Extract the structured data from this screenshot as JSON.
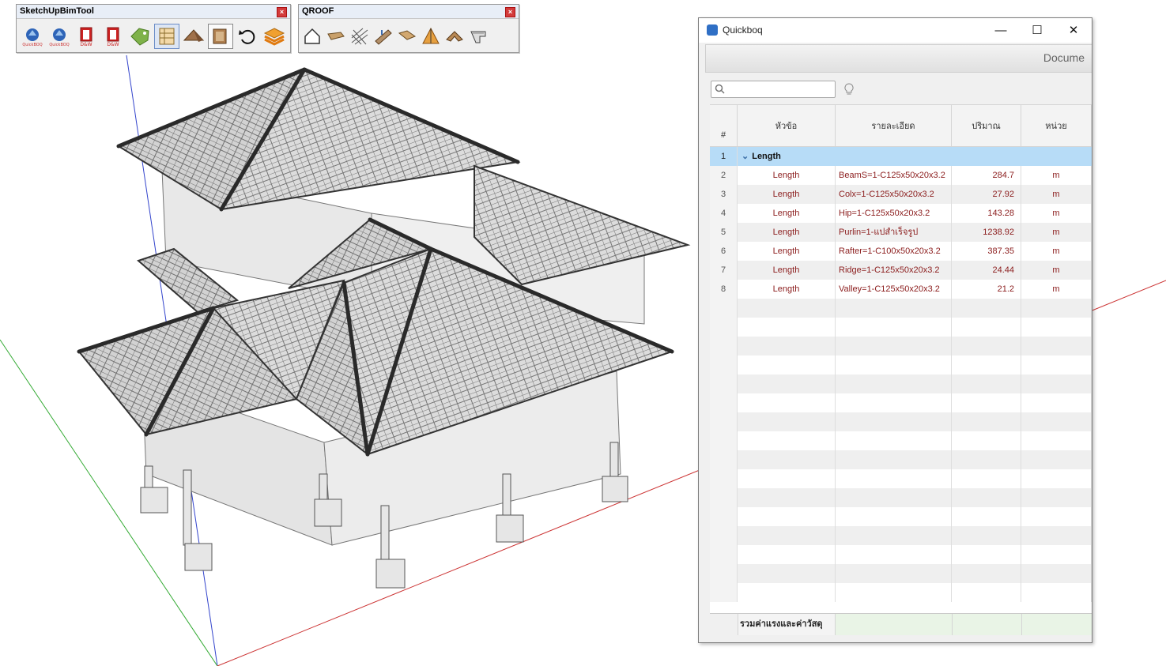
{
  "toolbars": {
    "bim": {
      "title": "SketchUpBimTool",
      "buttons": [
        {
          "icon": "quickboq-icon",
          "caption": "QuickBOQ"
        },
        {
          "icon": "quickboq-2-icon",
          "caption": "QuickBOQ"
        },
        {
          "icon": "door-window-icon",
          "caption": "D&W"
        },
        {
          "icon": "door-window-2-icon",
          "caption": "D&W"
        },
        {
          "icon": "tag-icon",
          "caption": ""
        },
        {
          "icon": "wall-grid-icon",
          "caption": ""
        },
        {
          "icon": "roof-icon",
          "caption": ""
        },
        {
          "icon": "panel-icon",
          "caption": ""
        },
        {
          "icon": "undo-rotate-icon",
          "caption": ""
        },
        {
          "icon": "layers-icon",
          "caption": ""
        }
      ]
    },
    "qroof": {
      "title": "QROOF",
      "buttons": [
        {
          "icon": "house-icon"
        },
        {
          "icon": "beam-icon"
        },
        {
          "icon": "grid-frame-icon"
        },
        {
          "icon": "purlin-icon"
        },
        {
          "icon": "rafter-icon"
        },
        {
          "icon": "gable-icon"
        },
        {
          "icon": "hip-icon"
        },
        {
          "icon": "valley-icon"
        },
        {
          "icon": "ridge-icon"
        }
      ]
    }
  },
  "quickboq": {
    "title": "Quickboq",
    "ribbon_label": "Docume",
    "search_placeholder": "",
    "columns": {
      "num": "#",
      "title": "หัวข้อ",
      "desc": "รายละเอียด",
      "qty": "ปริมาณ",
      "unit": "หน่วย"
    },
    "group": {
      "num": "1",
      "label": "Length"
    },
    "rows": [
      {
        "num": "2",
        "title": "Length",
        "desc": "BeamS=1-C125x50x20x3.2",
        "qty": "284.7",
        "unit": "m"
      },
      {
        "num": "3",
        "title": "Length",
        "desc": "Colx=1-C125x50x20x3.2",
        "qty": "27.92",
        "unit": "m"
      },
      {
        "num": "4",
        "title": "Length",
        "desc": "Hip=1-C125x50x20x3.2",
        "qty": "143.28",
        "unit": "m"
      },
      {
        "num": "5",
        "title": "Length",
        "desc": "Purlin=1-แปสำเร็จรูป",
        "qty": "1238.92",
        "unit": "m"
      },
      {
        "num": "6",
        "title": "Length",
        "desc": "Rafter=1-C100x50x20x3.2",
        "qty": "387.35",
        "unit": "m"
      },
      {
        "num": "7",
        "title": "Length",
        "desc": "Ridge=1-C125x50x20x3.2",
        "qty": "24.44",
        "unit": "m"
      },
      {
        "num": "8",
        "title": "Length",
        "desc": "Valley=1-C125x50x20x3.2",
        "qty": "21.2",
        "unit": "m"
      }
    ],
    "footer_label": "รวมค่าแรงและค่าวัสดุ"
  },
  "colors": {
    "group_row": "#b7dcf7",
    "cell_text": "#8b1c1c",
    "footer_green": "#e9f4e6"
  }
}
